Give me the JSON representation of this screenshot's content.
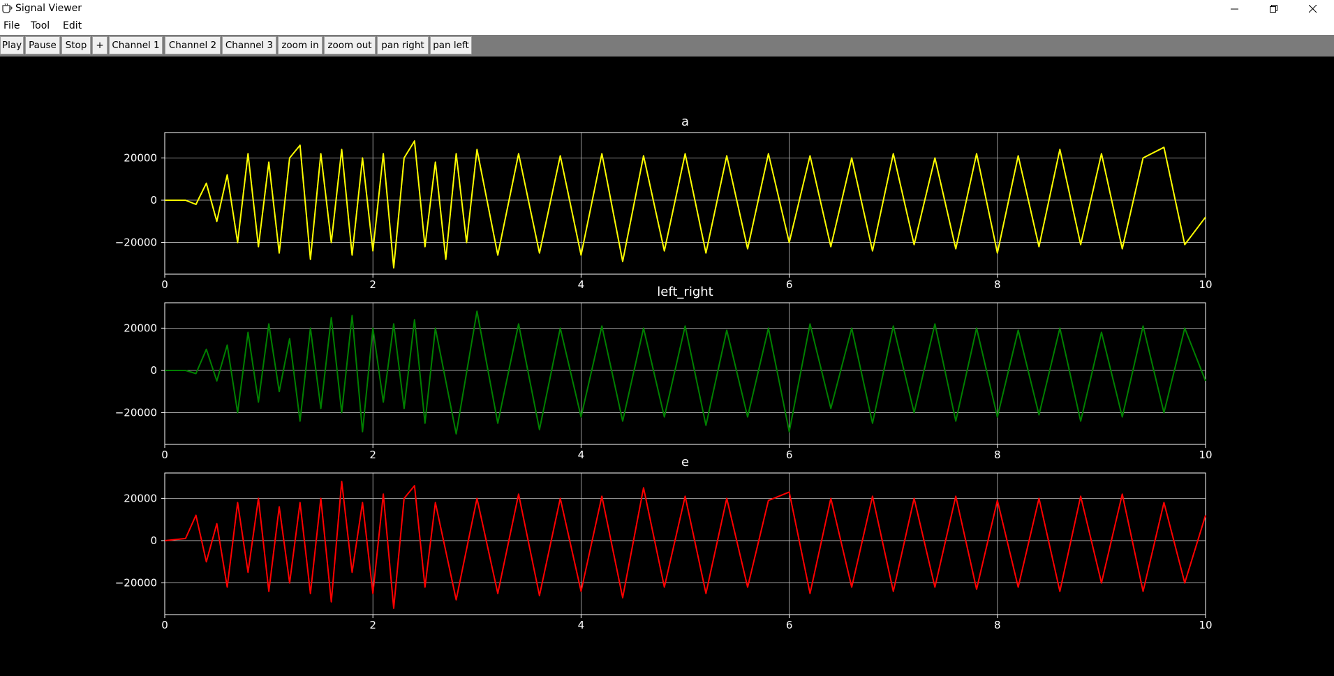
{
  "window": {
    "title": "Signal Viewer",
    "controls": [
      "minimize",
      "restore",
      "close"
    ]
  },
  "menu": {
    "items": [
      "File",
      "Tool",
      "Edit"
    ]
  },
  "toolbar": {
    "buttons": [
      "Play",
      "Pause",
      "Stop",
      "+",
      "Channel 1",
      "Channel 2",
      "Channel 3",
      "zoom in",
      "zoom out",
      "pan right",
      "pan left"
    ]
  },
  "colors": {
    "background": "#000000",
    "grid": "#bdbdbd",
    "toolbar": "#7b7b7b"
  },
  "chart_data": [
    {
      "type": "line",
      "title": "a",
      "xlim": [
        0,
        10
      ],
      "ylim": [
        -35000,
        32000
      ],
      "xticks": [
        0,
        2,
        4,
        6,
        8,
        10
      ],
      "yticks": [
        -20000,
        0,
        20000
      ],
      "ytick_labels": [
        "−20000",
        "0",
        "20000"
      ],
      "grid": true,
      "series": [
        {
          "color": "#ffff00",
          "x": [
            0,
            0.2,
            0.3,
            0.4,
            0.5,
            0.6,
            0.7,
            0.8,
            0.9,
            1.0,
            1.1,
            1.2,
            1.3,
            1.4,
            1.5,
            1.6,
            1.7,
            1.8,
            1.9,
            2.0,
            2.1,
            2.2,
            2.3,
            2.4,
            2.5,
            2.6,
            2.7,
            2.8,
            2.9,
            3.0,
            3.2,
            3.4,
            3.6,
            3.8,
            4.0,
            4.2,
            4.4,
            4.6,
            4.8,
            5.0,
            5.2,
            5.4,
            5.6,
            5.8,
            6.0,
            6.2,
            6.4,
            6.6,
            6.8,
            7.0,
            7.2,
            7.4,
            7.6,
            7.8,
            8.0,
            8.2,
            8.4,
            8.6,
            8.8,
            9.0,
            9.2,
            9.4,
            9.6,
            9.8,
            10.0
          ],
          "y": [
            0,
            0,
            -2000,
            8000,
            -10000,
            12000,
            -20000,
            22000,
            -22000,
            18000,
            -25000,
            20000,
            26000,
            -28000,
            22000,
            -20000,
            24000,
            -26000,
            20000,
            -24000,
            22000,
            -32000,
            20000,
            28000,
            -22000,
            18000,
            -28000,
            22000,
            -20000,
            24000,
            -26000,
            22000,
            -25000,
            21000,
            -26000,
            22000,
            -29000,
            21000,
            -24000,
            22000,
            -25000,
            21000,
            -23000,
            22000,
            -20000,
            21000,
            -22000,
            20000,
            -24000,
            22000,
            -21000,
            20000,
            -23000,
            22000,
            -25000,
            21000,
            -22000,
            24000,
            -21000,
            22000,
            -23000,
            20000,
            25000,
            -21000,
            -8000
          ]
        }
      ]
    },
    {
      "type": "line",
      "title": "left_right",
      "xlim": [
        0,
        10
      ],
      "ylim": [
        -35000,
        32000
      ],
      "xticks": [
        0,
        2,
        4,
        6,
        8,
        10
      ],
      "yticks": [
        -20000,
        0,
        20000
      ],
      "ytick_labels": [
        "−20000",
        "0",
        "20000"
      ],
      "grid": true,
      "series": [
        {
          "color": "#008000",
          "x": [
            0,
            0.2,
            0.3,
            0.4,
            0.5,
            0.6,
            0.7,
            0.8,
            0.9,
            1.0,
            1.1,
            1.2,
            1.3,
            1.4,
            1.5,
            1.6,
            1.7,
            1.8,
            1.9,
            2.0,
            2.1,
            2.2,
            2.3,
            2.4,
            2.5,
            2.6,
            2.8,
            3.0,
            3.2,
            3.4,
            3.6,
            3.8,
            4.0,
            4.2,
            4.4,
            4.6,
            4.8,
            5.0,
            5.2,
            5.4,
            5.6,
            5.8,
            6.0,
            6.2,
            6.4,
            6.6,
            6.8,
            7.0,
            7.2,
            7.4,
            7.6,
            7.8,
            8.0,
            8.2,
            8.4,
            8.6,
            8.8,
            9.0,
            9.2,
            9.4,
            9.6,
            9.8,
            10.0
          ],
          "y": [
            0,
            0,
            -1500,
            10000,
            -5000,
            12000,
            -20000,
            18000,
            -15000,
            22000,
            -10000,
            15000,
            -24000,
            20000,
            -18000,
            25000,
            -20000,
            26000,
            -29000,
            20000,
            -15000,
            22000,
            -18000,
            24000,
            -25000,
            20000,
            -30000,
            28000,
            -25000,
            22000,
            -28000,
            20000,
            -22000,
            21000,
            -24000,
            20000,
            -22000,
            21000,
            -26000,
            19000,
            -22000,
            20000,
            -29000,
            22000,
            -18000,
            20000,
            -25000,
            21000,
            -20000,
            22000,
            -24000,
            20000,
            -22000,
            19000,
            -21000,
            20000,
            -24000,
            18000,
            -22000,
            21000,
            -20000,
            20000,
            -5000
          ]
        }
      ]
    },
    {
      "type": "line",
      "title": "e",
      "xlim": [
        0,
        10
      ],
      "ylim": [
        -35000,
        32000
      ],
      "xticks": [
        0,
        2,
        4,
        6,
        8,
        10
      ],
      "yticks": [
        -20000,
        0,
        20000
      ],
      "ytick_labels": [
        "−20000",
        "0",
        "20000"
      ],
      "grid": true,
      "series": [
        {
          "color": "#ff0000",
          "x": [
            0,
            0.2,
            0.3,
            0.4,
            0.5,
            0.6,
            0.7,
            0.8,
            0.9,
            1.0,
            1.1,
            1.2,
            1.3,
            1.4,
            1.5,
            1.6,
            1.7,
            1.8,
            1.9,
            2.0,
            2.1,
            2.2,
            2.3,
            2.4,
            2.5,
            2.6,
            2.8,
            3.0,
            3.2,
            3.4,
            3.6,
            3.8,
            4.0,
            4.2,
            4.4,
            4.6,
            4.8,
            5.0,
            5.2,
            5.4,
            5.6,
            5.8,
            6.0,
            6.2,
            6.4,
            6.6,
            6.8,
            7.0,
            7.2,
            7.4,
            7.6,
            7.8,
            8.0,
            8.2,
            8.4,
            8.6,
            8.8,
            9.0,
            9.2,
            9.4,
            9.6,
            9.8,
            10.0
          ],
          "y": [
            0,
            1000,
            12000,
            -10000,
            8000,
            -22000,
            18000,
            -15000,
            20000,
            -24000,
            16000,
            -20000,
            18000,
            -25000,
            20000,
            -29000,
            28000,
            -15000,
            18000,
            -25000,
            22000,
            -32000,
            20000,
            26000,
            -22000,
            18000,
            -28000,
            20000,
            -25000,
            22000,
            -26000,
            20000,
            -24000,
            21000,
            -27000,
            25000,
            -22000,
            21000,
            -25000,
            20000,
            -22000,
            19000,
            23000,
            -25000,
            20000,
            -22000,
            21000,
            -24000,
            20000,
            -22000,
            21000,
            -23000,
            19000,
            -22000,
            20000,
            -24000,
            21000,
            -20000,
            22000,
            -24000,
            18000,
            -20000,
            12000
          ]
        }
      ]
    }
  ]
}
